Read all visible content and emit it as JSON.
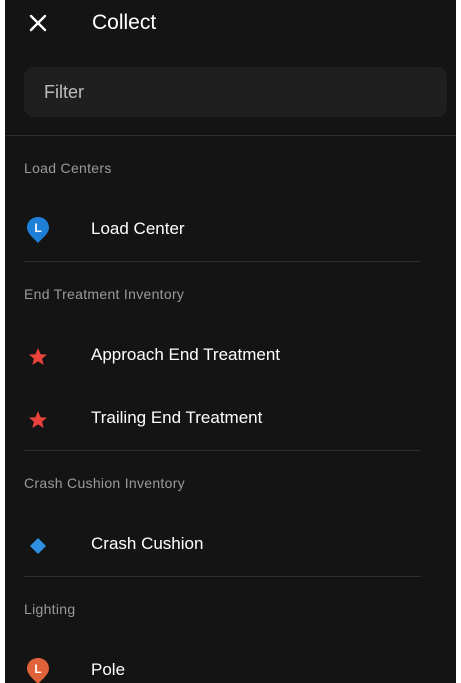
{
  "header": {
    "title": "Collect",
    "close_icon": "close-icon"
  },
  "filter": {
    "placeholder": "Filter",
    "value": ""
  },
  "sections": [
    {
      "title": "Load Centers",
      "items": [
        {
          "label": "Load Center",
          "icon": "blue-pin-L-icon",
          "color": "#1e7fd6"
        }
      ]
    },
    {
      "title": "End Treatment Inventory",
      "items": [
        {
          "label": "Approach End Treatment",
          "icon": "red-star-icon",
          "color": "#e8423a"
        },
        {
          "label": "Trailing End Treatment",
          "icon": "red-star-icon",
          "color": "#e8423a"
        }
      ]
    },
    {
      "title": "Crash Cushion Inventory",
      "items": [
        {
          "label": "Crash Cushion",
          "icon": "blue-diamond-icon",
          "color": "#2f8fe0"
        }
      ]
    },
    {
      "title": "Lighting",
      "items": [
        {
          "label": "Pole",
          "icon": "orange-pin-L-icon",
          "color": "#e0623a"
        }
      ]
    }
  ],
  "colors": {
    "background": "#141414",
    "filter_background": "#1f1f1f",
    "divider": "#2e2e2e",
    "section_text": "#9a9a9a",
    "item_text": "#ffffff"
  }
}
